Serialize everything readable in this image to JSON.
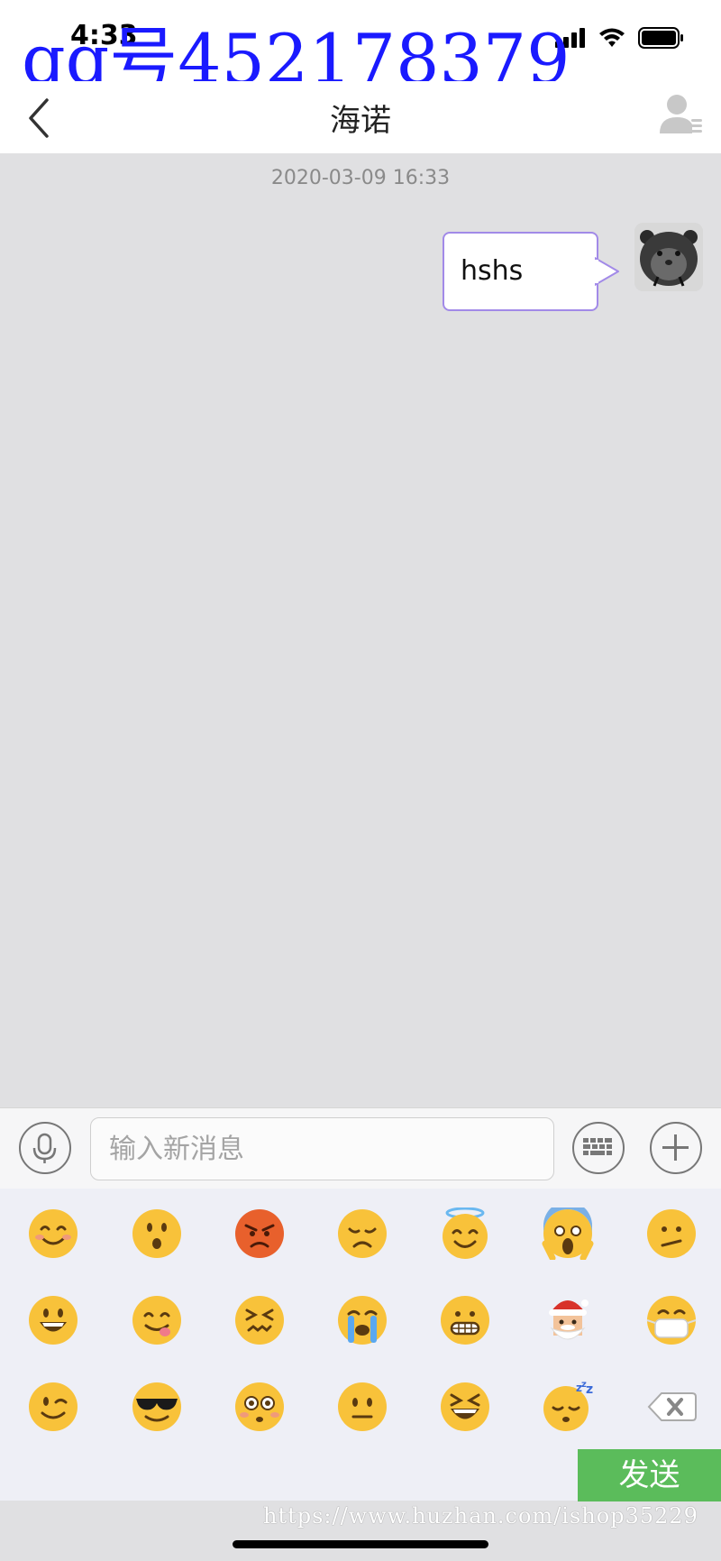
{
  "status_bar": {
    "time": "4:33",
    "icons": [
      "signal-icon",
      "wifi-icon",
      "battery-icon"
    ]
  },
  "watermark": {
    "text": "qq号452178379",
    "url": "https://www.huzhan.com/ishop35229",
    "color": "#1a1aff"
  },
  "nav": {
    "title": "海诺",
    "back_icon": "chevron-left-icon",
    "profile_icon": "user-profile-icon"
  },
  "chat": {
    "timestamp": "2020-03-09 16:33",
    "messages": [
      {
        "sender": "self",
        "text": "hshs",
        "avatar": "hamster-avatar"
      }
    ],
    "bubble_border_color": "#a28ae8"
  },
  "input": {
    "placeholder": "输入新消息",
    "value": "",
    "mic_icon": "microphone-icon",
    "keyboard_icon": "keyboard-icon",
    "plus_icon": "plus-icon"
  },
  "emoji_panel": {
    "rows": [
      [
        "smiling-face",
        "surprised-face",
        "angry-face",
        "disappointed-face",
        "angel-face",
        "screaming-face",
        "confused-face"
      ],
      [
        "grinning-face",
        "yum-face",
        "confounded-face",
        "crying-face",
        "grimacing-face",
        "santa-face",
        "mask-face"
      ],
      [
        "winking-face",
        "sunglasses-face",
        "flushed-face",
        "neutral-face",
        "laughing-face",
        "sleeping-face",
        "delete-key-icon"
      ]
    ]
  },
  "send_button": {
    "label": "发送",
    "color": "#5bbc5b"
  }
}
